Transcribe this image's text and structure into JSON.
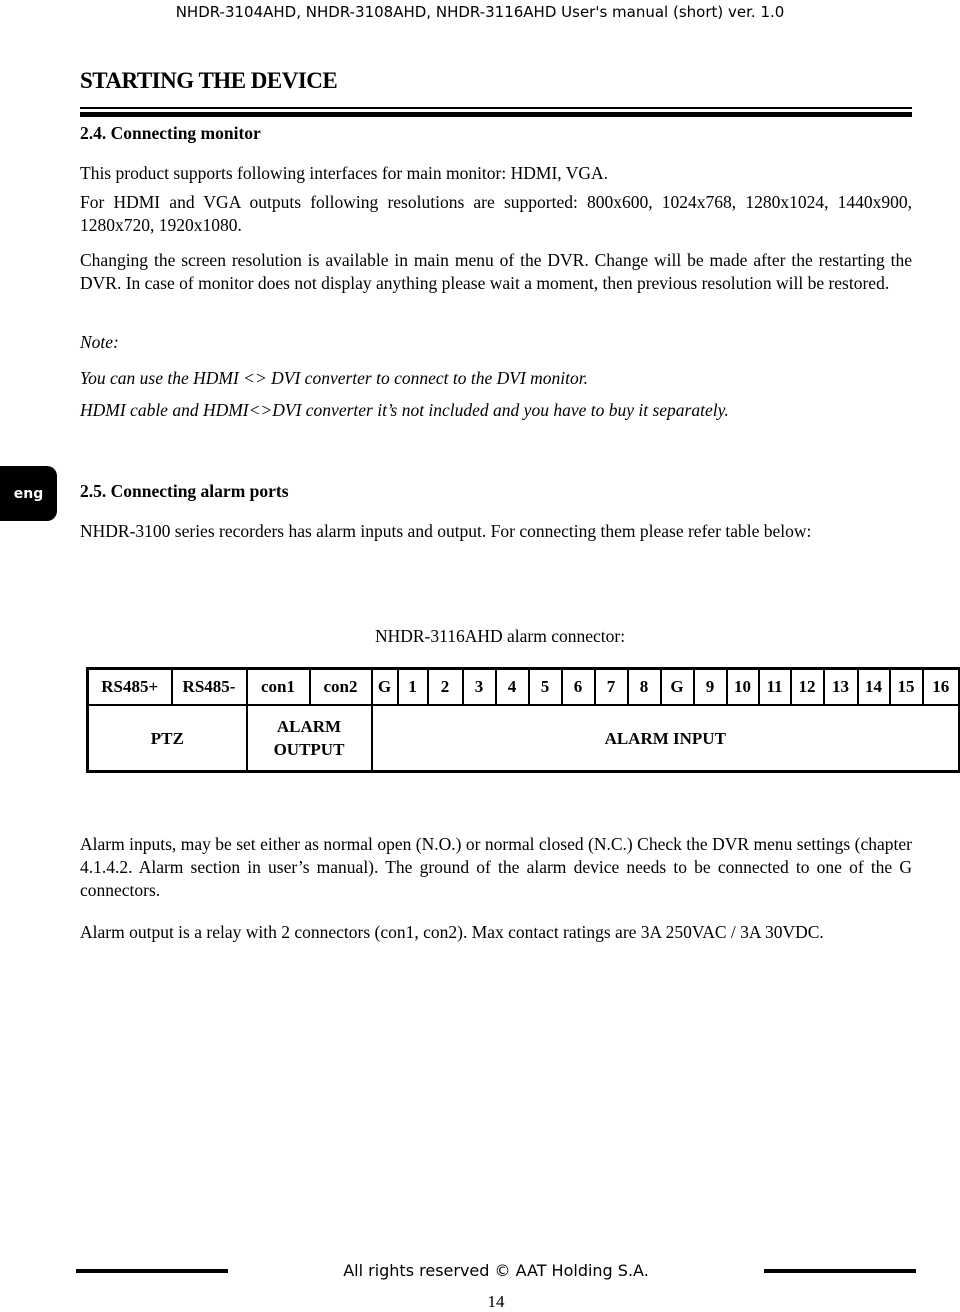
{
  "header": "NHDR-3104AHD, NHDR-3108AHD, NHDR-3116AHD User's manual (short) ver. 1.0",
  "title": "STARTING THE DEVICE",
  "side_tab": "eng",
  "s24": {
    "heading": "2.4. Connecting monitor",
    "p1": "This product supports following interfaces for main monitor: HDMI, VGA.",
    "p2": "For HDMI and VGA outputs following resolutions are supported: 800x600, 1024x768, 1280x1024, 1440x900, 1280x720, 1920x1080.",
    "p3": "Changing the screen resolution is available in main menu of the DVR. Change will be made after the restarting the DVR. In case of monitor does not display anything please wait a moment, then previous resolution will be restored.",
    "note_label": "Note:",
    "note1": "You can use the HDMI <> DVI converter to connect to the DVI monitor.",
    "note2": "HDMI cable and HDMI<>DVI converter it’s not included and you have to buy it separately."
  },
  "s25": {
    "heading": "2.5. Connecting alarm ports",
    "p1": "NHDR-3100 series recorders has alarm inputs and output. For connecting them please refer table below:",
    "caption": "NHDR-3116AHD alarm connector:",
    "pins": [
      "RS485+",
      "RS485-",
      "con1",
      "con2",
      "G",
      "1",
      "2",
      "3",
      "4",
      "5",
      "6",
      "7",
      "8",
      "G",
      "9",
      "10",
      "11",
      "12",
      "13",
      "14",
      "15",
      "16"
    ],
    "groups": [
      "PTZ",
      "ALARM OUTPUT",
      "ALARM INPUT"
    ],
    "p2": "Alarm inputs, may be set either as normal open (N.O.) or normal closed (N.C.) Check the DVR menu settings (chapter 4.1.4.2. Alarm section in user’s manual). The ground of the alarm device needs to be connected to one of the G connectors.",
    "p3": "Alarm output is a relay with 2 connectors (con1, con2).  Max contact ratings are 3A 250VAC / 3A 30VDC."
  },
  "footer": "All rights reserved © AAT Holding S.A.",
  "page_number": "14"
}
